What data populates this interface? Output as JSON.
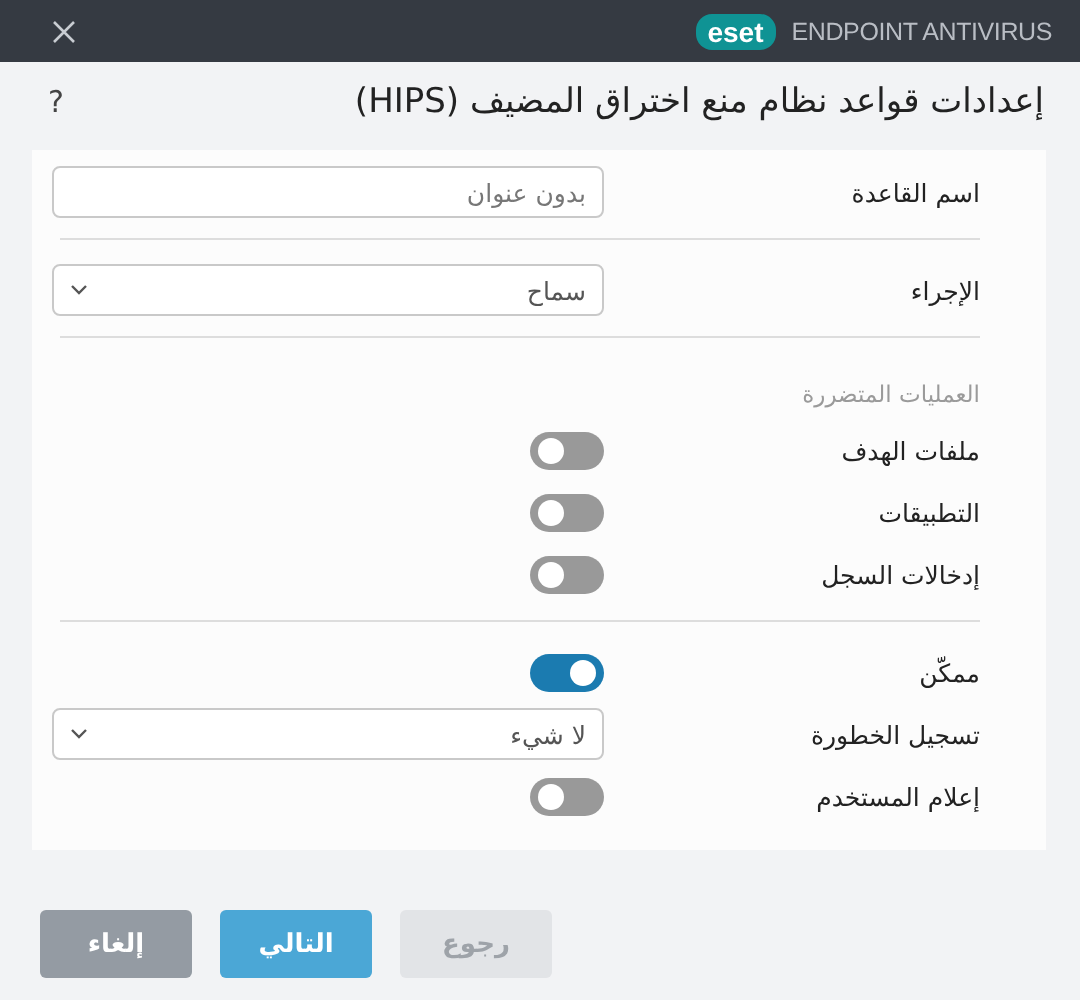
{
  "header": {
    "brand_badge": "eset",
    "product": "ENDPOINT ANTIVIRUS"
  },
  "title": "إعدادات قواعد نظام منع اختراق المضيف (HIPS)",
  "help": "?",
  "rows": [
    {
      "kind": "field",
      "label": "اسم القاعدة",
      "placeholder": "بدون عنوان"
    },
    {
      "kind": "divider"
    },
    {
      "kind": "select",
      "label": "الإجراء",
      "value": "سماح"
    },
    {
      "kind": "divider"
    },
    {
      "kind": "heading",
      "label": "العمليات المتضررة"
    },
    {
      "kind": "toggle",
      "label": "ملفات الهدف",
      "on": false
    },
    {
      "kind": "toggle",
      "label": "التطبيقات",
      "on": false
    },
    {
      "kind": "toggle",
      "label": "إدخالات السجل",
      "on": false
    },
    {
      "kind": "divider"
    },
    {
      "kind": "toggle",
      "label": "ممكّن",
      "on": true
    },
    {
      "kind": "select",
      "label": "تسجيل الخطورة",
      "value": "لا شيء"
    },
    {
      "kind": "toggle",
      "label": "إعلام المستخدم",
      "on": false
    }
  ],
  "buttons": [
    {
      "kind": "secondary",
      "label": "رجوع",
      "disabled": true
    },
    {
      "kind": "primary",
      "label": "التالي",
      "disabled": false
    },
    {
      "kind": "secondary",
      "label": "إلغاء",
      "disabled": false
    }
  ]
}
